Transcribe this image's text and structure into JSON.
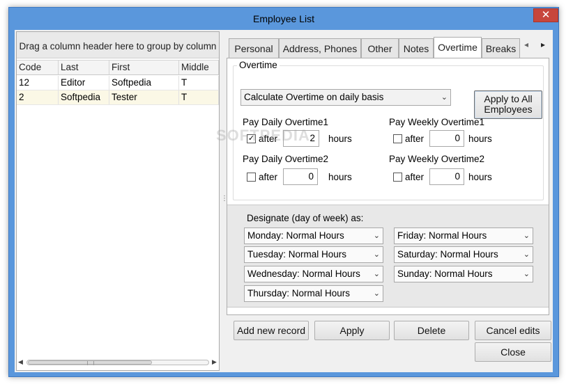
{
  "window": {
    "title": "Employee List",
    "close_glyph": "✕"
  },
  "grid": {
    "group_hint": "Drag a column header here to group by column",
    "columns": [
      "Code",
      "Last",
      "First",
      "Middle"
    ],
    "rows": [
      [
        "12",
        "Editor",
        "Softpedia",
        "T"
      ],
      [
        "2",
        "Softpedia",
        "Tester",
        "T"
      ]
    ],
    "selected_row_color": "#fbf8e6"
  },
  "tabs": [
    "Personal",
    "Address, Phones",
    "Other",
    "Notes",
    "Overtime",
    "Breaks"
  ],
  "active_tab": "Overtime",
  "overtime": {
    "legend": "Overtime",
    "calc_mode": "Calculate Overtime on daily basis",
    "apply_all": "Apply to All Employees",
    "daily1": {
      "label": "Pay Daily Overtime1",
      "checked": true,
      "after": "after",
      "value": "2",
      "unit": "hours"
    },
    "weekly1": {
      "label": "Pay Weekly Overtime1",
      "checked": false,
      "after": "after",
      "value": "0",
      "unit": "hours"
    },
    "daily2": {
      "label": "Pay Daily Overtime2",
      "checked": false,
      "after": "after",
      "value": "0",
      "unit": "hours"
    },
    "weekly2": {
      "label": "Pay Weekly Overtime2",
      "checked": false,
      "after": "after",
      "value": "0",
      "unit": "hours"
    }
  },
  "designate": {
    "label": "Designate (day of week) as:",
    "days": [
      "Monday: Normal Hours",
      "Friday: Normal Hours",
      "Tuesday: Normal Hours",
      "Saturday: Normal Hours",
      "Wednesday: Normal Hours",
      "Sunday: Normal Hours",
      "Thursday: Normal Hours"
    ]
  },
  "buttons": {
    "add": "Add new record",
    "apply": "Apply",
    "delete": "Delete",
    "cancel": "Cancel edits",
    "close": "Close"
  },
  "watermark": "SOFTPEDIA",
  "colors": {
    "titlebar": "#5a97dc",
    "close": "#c7463c",
    "panel": "#f0f0f0"
  }
}
